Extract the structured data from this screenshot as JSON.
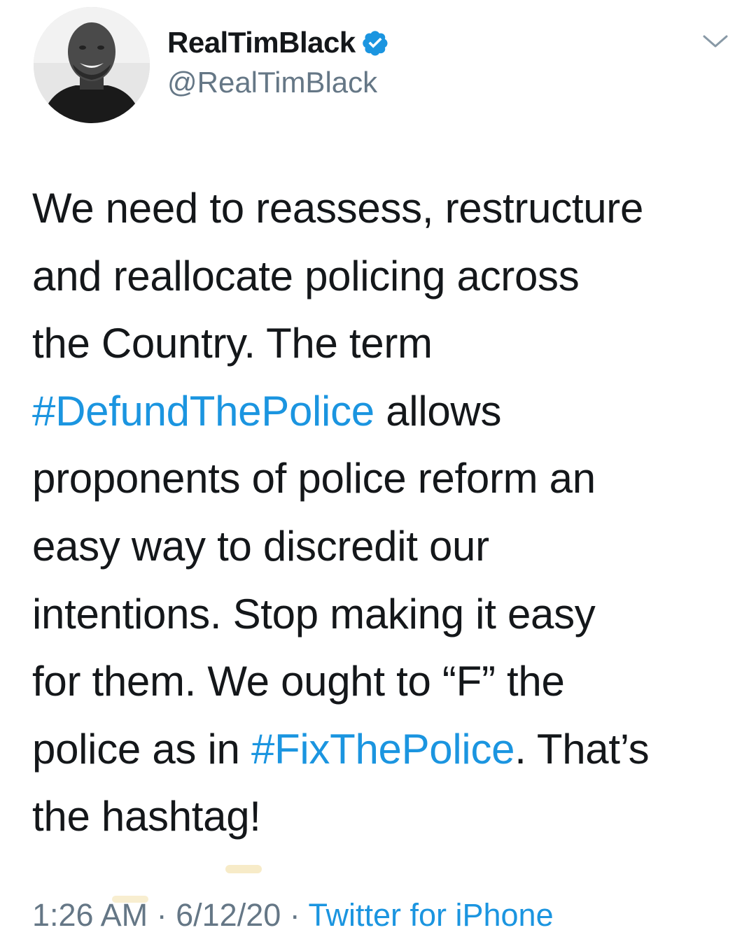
{
  "author": {
    "display_name": "RealTimBlack",
    "handle": "@RealTimBlack",
    "verified_color": "#1b95e0"
  },
  "tweet": {
    "lines": [
      [
        {
          "t": "We need to reassess, restructure",
          "type": "text"
        }
      ],
      [
        {
          "t": "and reallocate policing across",
          "type": "text"
        }
      ],
      [
        {
          "t": "the Country. The term",
          "type": "text"
        }
      ],
      [
        {
          "t": "#DefundThePolice",
          "type": "hashtag"
        },
        {
          "t": " allows",
          "type": "text"
        }
      ],
      [
        {
          "t": "proponents of police reform an",
          "type": "text"
        }
      ],
      [
        {
          "t": "easy way to discredit our",
          "type": "text"
        }
      ],
      [
        {
          "t": "intentions. Stop making it easy",
          "type": "text"
        }
      ],
      [
        {
          "t": "for them. We ought to “F” the",
          "type": "text"
        }
      ],
      [
        {
          "t": "police as in ",
          "type": "text"
        },
        {
          "t": "#FixThePolice",
          "type": "hashtag"
        },
        {
          "t": ". That’s",
          "type": "text"
        }
      ],
      [
        {
          "t": "the hashtag!",
          "type": "text"
        }
      ]
    ]
  },
  "meta": {
    "time": "1:26 AM",
    "separator": " · ",
    "date": "6/12/20",
    "source": "Twitter for iPhone"
  },
  "colors": {
    "text": "#14171a",
    "secondary": "#657786",
    "link": "#1b95e0"
  },
  "icons": {
    "verified": "verified-badge-icon",
    "caret": "chevron-down-icon",
    "avatar": "profile-photo"
  }
}
